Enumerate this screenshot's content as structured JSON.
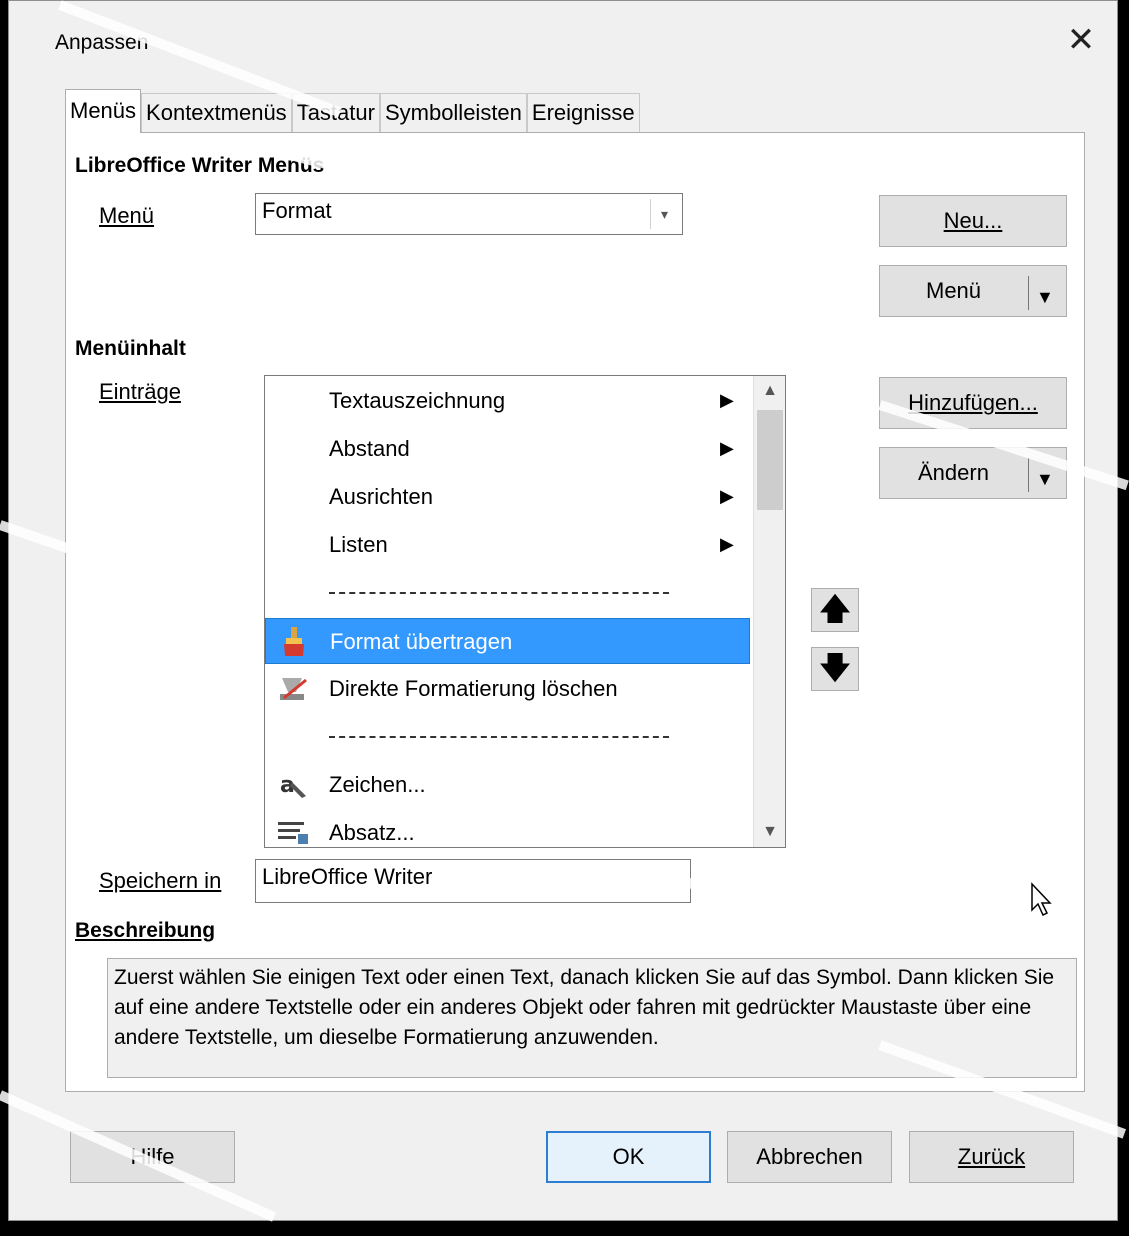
{
  "dialog": {
    "title": "Anpassen",
    "close_glyph": "✕"
  },
  "tabs": [
    {
      "label": "Menüs",
      "active": true
    },
    {
      "label": "Kontextmenüs",
      "active": false
    },
    {
      "label": "Tastatur",
      "active": false
    },
    {
      "label": "Symbolleisten",
      "active": false
    },
    {
      "label": "Ereignisse",
      "active": false
    }
  ],
  "menus_section": {
    "heading": "LibreOffice Writer Menüs",
    "menu_label": "Menü",
    "menu_value": "Format",
    "new_button": "Neu...",
    "menu_button": "Menü"
  },
  "content_section": {
    "heading": "Menüinhalt",
    "entries_label": "Einträge",
    "add_button": "Hinzufügen...",
    "change_button": "Ändern",
    "entries": [
      {
        "label": "Textauszeichnung",
        "submenu": true,
        "icon": ""
      },
      {
        "label": "Abstand",
        "submenu": true,
        "icon": ""
      },
      {
        "label": "Ausrichten",
        "submenu": true,
        "icon": ""
      },
      {
        "label": "Listen",
        "submenu": true,
        "icon": ""
      },
      {
        "label": "",
        "separator": true
      },
      {
        "label": "Format übertragen",
        "icon": "paintbrush-icon",
        "selected": true
      },
      {
        "label": "Direkte Formatierung löschen",
        "icon": "clear-formatting-icon"
      },
      {
        "label": "",
        "separator": true
      },
      {
        "label": "Zeichen...",
        "icon": "character-icon"
      },
      {
        "label": "Absatz...",
        "icon": "paragraph-icon"
      }
    ],
    "save_in_label": "Speichern in",
    "save_in_value": "LibreOffice Writer"
  },
  "description": {
    "heading": "Beschreibung",
    "text": "Zuerst wählen Sie einigen Text oder einen Text, danach klicken Sie auf das Symbol. Dann klicken Sie auf eine andere Textstelle oder ein anderes Objekt oder fahren mit gedrückter Maustaste über eine andere Textstelle, um dieselbe Formatierung anzuwenden."
  },
  "footer": {
    "help": "Hilfe",
    "ok": "OK",
    "cancel": "Abbrechen",
    "reset": "Zurück"
  },
  "colors": {
    "selection": "#3399ff",
    "default_button_border": "#2d7dd2"
  }
}
